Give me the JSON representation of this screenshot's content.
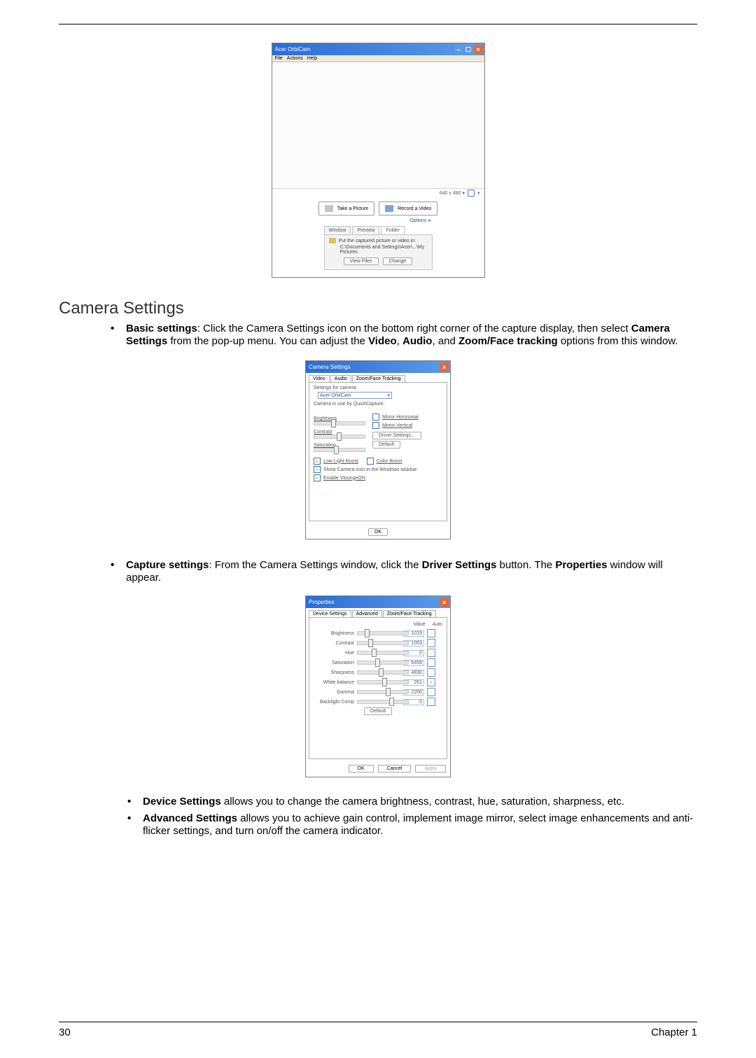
{
  "page": {
    "number": "30",
    "chapter": "Chapter 1"
  },
  "heading": "Camera Settings",
  "body": {
    "basic_label": "Basic settings",
    "basic_text_a": ": Click the Camera Settings icon on the bottom right corner of the capture display, then select ",
    "basic_cs": "Camera Settings",
    "basic_text_b": " from the pop-up menu. You can adjust the ",
    "video": "Video",
    "comma1": ", ",
    "audio": "Audio",
    "comma2": ", and ",
    "zoomface": "Zoom/Face tracking",
    "basic_text_c": " options from this window.",
    "capture_label": "Capture settings",
    "capture_text_a": ": From the Camera Settings window, click the ",
    "driver_btn": "Driver Settings",
    "capture_text_b": " button. The ",
    "properties": "Properties",
    "capture_text_c": " window will appear.",
    "device_label": "Device Settings",
    "device_text": " allows you to change the camera brightness, contrast, hue, saturation, sharpness, etc.",
    "advanced_label": "Advanced Settings",
    "advanced_text": " allows you to achieve gain control, implement image mirror, select image enhancements and anti-flicker settings, and turn on/off the camera indicator."
  },
  "shot1": {
    "title": "Acer OrbiCam",
    "menu_file": "File",
    "menu_actions": "Actions",
    "menu_help": "Help",
    "resolution": "640 x 480 ▾",
    "take_picture": "Take a Picture",
    "record_video": "Record a Video",
    "options": "Options",
    "tab_window": "Window",
    "tab_preview": "Preview",
    "tab_folder": "Folder",
    "put_label": "Put the captured picture or video in:",
    "path": "C:\\Documents and Settings\\Acer\\...\\My Pictures",
    "view_files": "View Files",
    "change": "Change"
  },
  "shot2": {
    "title": "Camera Settings",
    "tab_video": "Video",
    "tab_audio": "Audio",
    "tab_zoom": "Zoom/Face Tracking",
    "settings_for": "Settings for camera:",
    "camera_name": "Acer OrbiCam",
    "in_use": "Camera in use by QuickCapture.",
    "brightness": "Brightness",
    "contrast": "Contrast",
    "saturation": "Saturation",
    "mirror_h": "Mirror Horizontal",
    "mirror_v": "Mirror Vertical",
    "driver_settings": "Driver Settings...",
    "default": "Default",
    "low_light": "Low Light Boost",
    "color_boost": "Color Boost",
    "show_icon": "Show Camera icon in the Windows taskbar.",
    "enable_vlounge": "Enable VloungeON",
    "ok": "OK"
  },
  "shot3": {
    "title": "Properties",
    "tab_device": "Device Settings",
    "tab_advanced": "Advanced",
    "tab_zoom": "Zoom/Face Tracking",
    "col_value": "Value",
    "col_auto": "Auto",
    "rows": [
      {
        "name": "Brightness",
        "value": "1019",
        "auto": false
      },
      {
        "name": "Contrast",
        "value": "1003",
        "auto": false
      },
      {
        "name": "Hue",
        "value": "0",
        "auto": false
      },
      {
        "name": "Saturation",
        "value": "6456",
        "auto": false
      },
      {
        "name": "Sharpness",
        "value": "4830",
        "auto": false
      },
      {
        "name": "White balance",
        "value": "261",
        "auto": true
      },
      {
        "name": "Gamma",
        "value": "2200",
        "auto": false
      },
      {
        "name": "Backlight Comp",
        "value": "0",
        "auto": false
      }
    ],
    "default": "Default",
    "ok": "OK",
    "cancel": "Cancel",
    "apply": "Apply"
  }
}
